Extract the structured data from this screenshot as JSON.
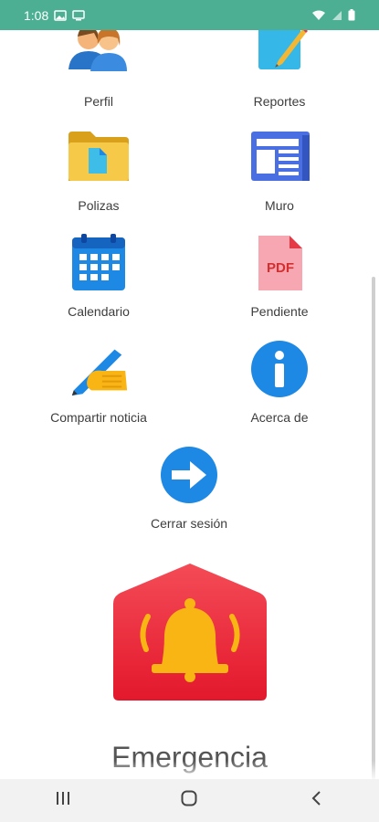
{
  "status_bar": {
    "time": "1:08",
    "icons": [
      "gallery-icon",
      "cast-icon",
      "wifi-icon",
      "signal-icon",
      "battery-icon"
    ]
  },
  "menu": {
    "tiles": [
      {
        "label": "Perfil",
        "icon": "users-icon"
      },
      {
        "label": "Reportes",
        "icon": "document-edit-icon"
      },
      {
        "label": "Polizas",
        "icon": "folder-icon"
      },
      {
        "label": "Muro",
        "icon": "newsfeed-icon"
      },
      {
        "label": "Calendario",
        "icon": "calendar-icon"
      },
      {
        "label": "Pendiente",
        "icon": "pdf-icon"
      },
      {
        "label": "Compartir noticia",
        "icon": "write-hand-icon"
      },
      {
        "label": "Acerca de",
        "icon": "info-icon"
      },
      {
        "label": "Cerrar sesión",
        "icon": "arrow-right-icon"
      }
    ],
    "pdf_badge": "PDF"
  },
  "emergency": {
    "label": "Emergencia",
    "icon": "alarm-bell-house-icon"
  },
  "nav_bar": {
    "buttons": [
      "recent-apps-icon",
      "home-icon",
      "back-icon"
    ]
  },
  "colors": {
    "status_bar": "#4caf93",
    "blue": "#1e88e5",
    "red": "#e53945",
    "yellow": "#f9b514"
  }
}
